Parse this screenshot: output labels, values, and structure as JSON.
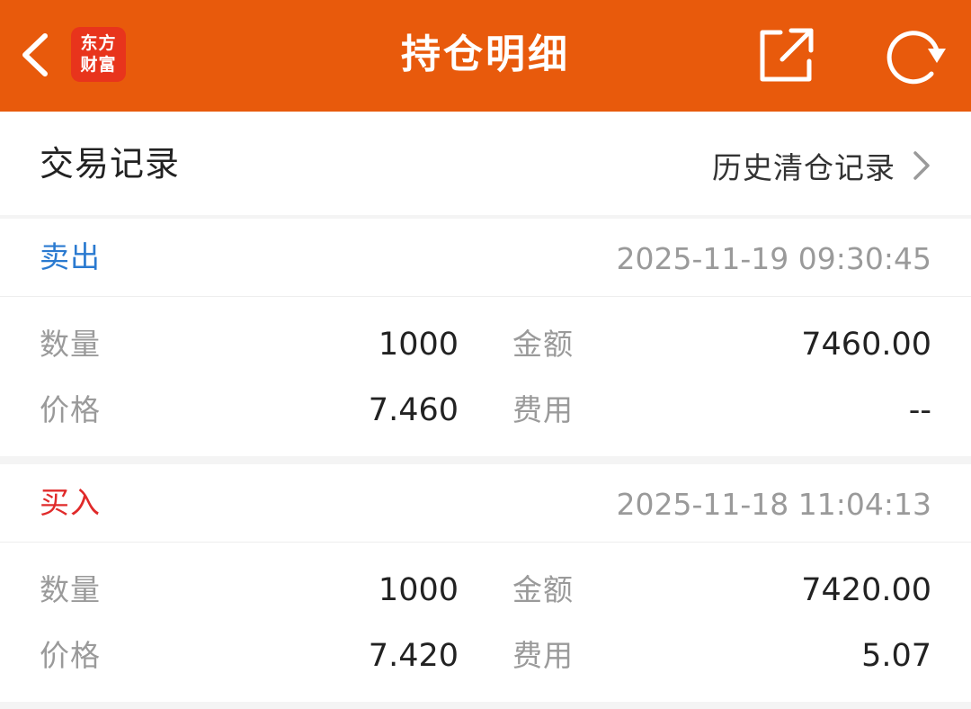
{
  "header": {
    "title": "持仓明细",
    "logo_line1": "东方",
    "logo_line2": "财富",
    "brand_color": "#e85a0c",
    "icons": [
      "back-icon",
      "share-icon",
      "refresh-icon"
    ]
  },
  "section": {
    "title": "交易记录",
    "history_link": "历史清仓记录"
  },
  "trades": [
    {
      "type": "卖出",
      "type_color": "#2a7ad0",
      "time": "2025-11-19 09:30:45",
      "qty_label": "数量",
      "qty": "1000",
      "amount_label": "金额",
      "amount": "7460.00",
      "price_label": "价格",
      "price": "7.460",
      "fee_label": "费用",
      "fee": "--"
    },
    {
      "type": "买入",
      "type_color": "#e02a2a",
      "time": "2025-11-18 11:04:13",
      "qty_label": "数量",
      "qty": "1000",
      "amount_label": "金额",
      "amount": "7420.00",
      "price_label": "价格",
      "price": "7.420",
      "fee_label": "费用",
      "fee": "5.07"
    }
  ]
}
